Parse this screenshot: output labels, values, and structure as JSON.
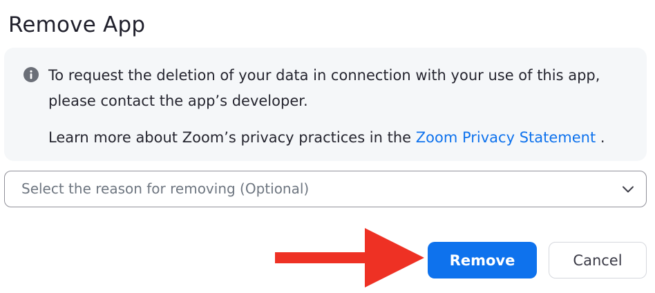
{
  "dialog": {
    "title": "Remove App"
  },
  "info": {
    "icon": "info-circle-icon",
    "line1": "To request the deletion of your data in connection with your use of this app, please contact the app’s developer.",
    "line2_prefix": "Learn more about Zoom’s privacy practices in the ",
    "line2_link": "Zoom Privacy Statement",
    "line2_suffix": " ."
  },
  "reason_select": {
    "placeholder": "Select the reason for removing (Optional)",
    "icon": "chevron-down-icon"
  },
  "annotation": {
    "icon": "red-arrow-icon",
    "color": "#ee3124"
  },
  "buttons": {
    "remove_label": "Remove",
    "cancel_label": "Cancel"
  },
  "colors": {
    "accent": "#0e72ed",
    "info_background": "#f5f7f9",
    "select_border": "#8f8f98",
    "placeholder_text": "#6e7680"
  }
}
